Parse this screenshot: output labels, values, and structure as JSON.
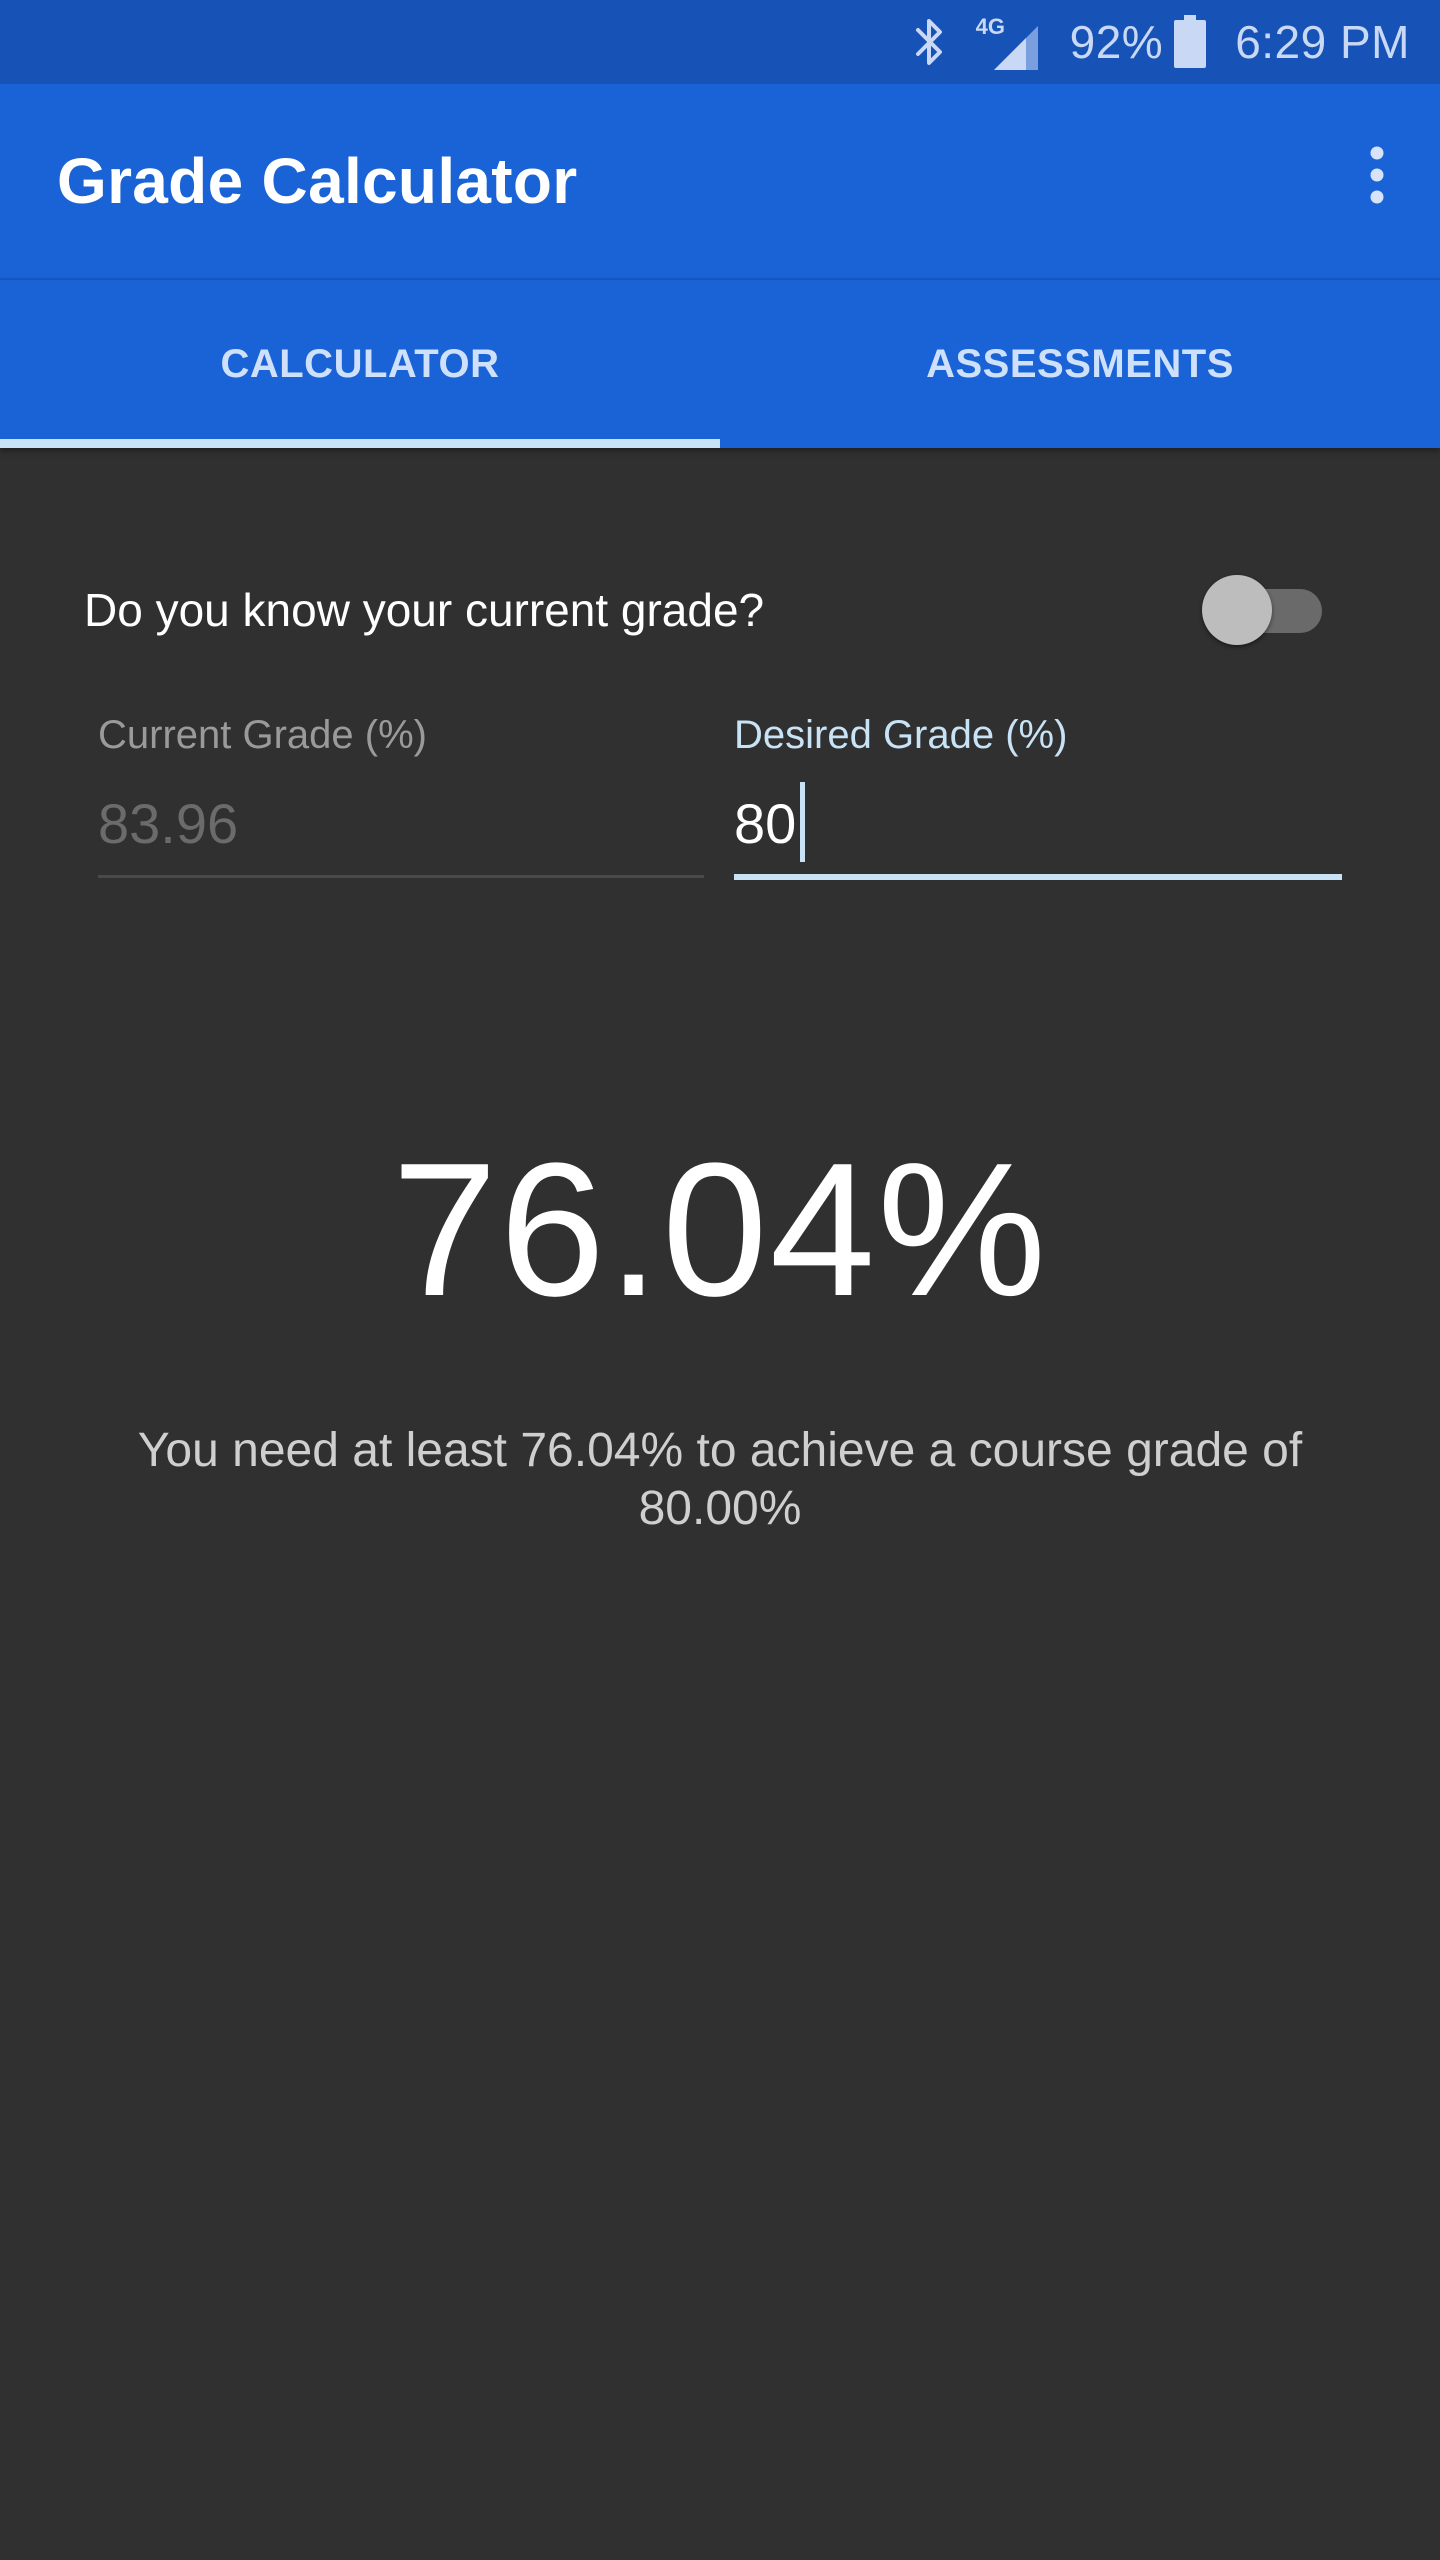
{
  "status_bar": {
    "battery_text": "92%",
    "time": "6:29 PM",
    "network_label": "4G",
    "icons": [
      "bluetooth-icon",
      "signal-icon",
      "battery-icon"
    ]
  },
  "app_bar": {
    "title": "Grade Calculator",
    "menu_icon": "overflow-menu-icon"
  },
  "tabs": [
    {
      "label": "CALCULATOR",
      "active": true
    },
    {
      "label": "ASSESSMENTS",
      "active": false
    }
  ],
  "form": {
    "question": "Do you know your current grade?",
    "toggle_on": false,
    "current_grade": {
      "label": "Current Grade (%)",
      "value": "83.96"
    },
    "desired_grade": {
      "label": "Desired Grade (%)",
      "value": "80"
    }
  },
  "result": {
    "value": "76.04%",
    "message": "You need at least 76.04% to achieve a course grade of 80.00%"
  },
  "colors": {
    "primary": "#1a63d6",
    "primary_dark": "#1753b7",
    "accent": "#c8e2f6",
    "background": "#303030"
  }
}
